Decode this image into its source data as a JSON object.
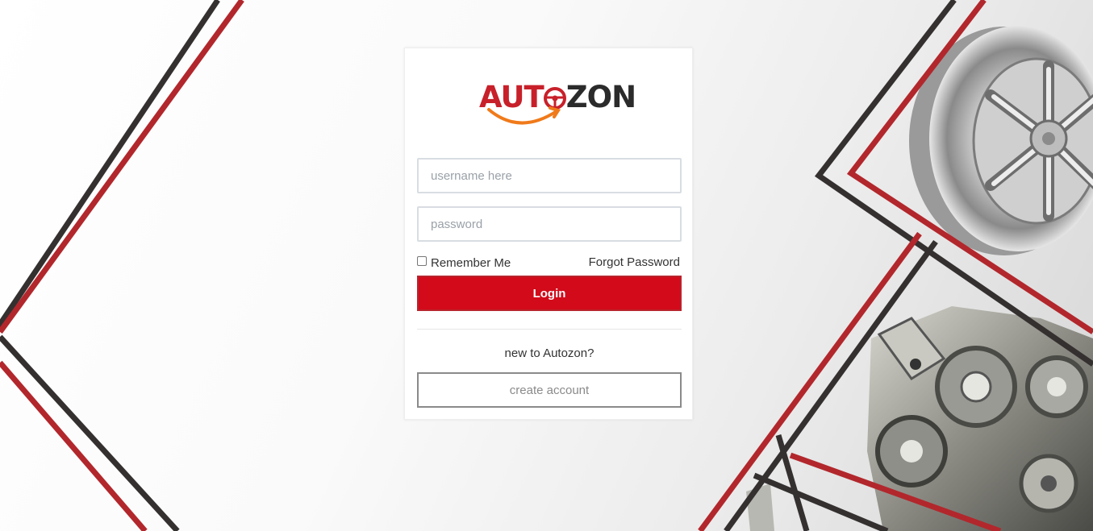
{
  "brand": {
    "logo_part1": "AUT",
    "logo_part2": "ZON",
    "accent_color": "#c8202a",
    "dark_color": "#2b2b2b",
    "swoosh_color": "#f07a1a"
  },
  "form": {
    "username_placeholder": "username here",
    "password_placeholder": "password",
    "remember_label": "Remember Me",
    "forgot_label": "Forgot Password",
    "login_label": "Login",
    "new_prompt": "new to Autozon?",
    "create_label": "create account"
  },
  "colors": {
    "login_bg": "#d20a1a",
    "stripe_red": "#b2272c",
    "stripe_dark": "#353030"
  },
  "decor": {
    "background_images": [
      "chrome-wheel",
      "engine-gears"
    ]
  }
}
